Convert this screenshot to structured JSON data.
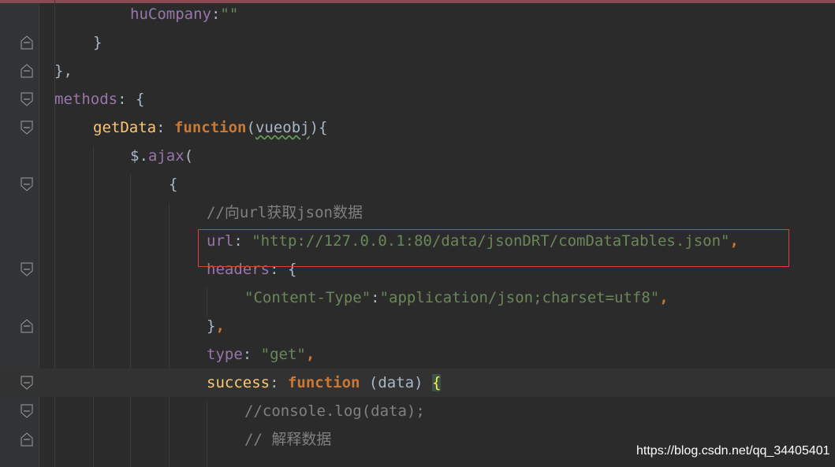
{
  "editor": {
    "lines": [
      {
        "tokens": [
          {
            "t": "huCompany",
            "c": "t-prop"
          },
          {
            "t": ":",
            "c": "t-def"
          },
          {
            "t": "\"\"",
            "c": "t-str"
          }
        ]
      },
      {
        "tokens": [
          {
            "t": "}",
            "c": "t-def"
          }
        ]
      },
      {
        "tokens": [
          {
            "t": "},",
            "c": "t-def"
          }
        ]
      },
      {
        "tokens": [
          {
            "t": "methods",
            "c": "t-prop"
          },
          {
            "t": ": {",
            "c": "t-def"
          }
        ]
      },
      {
        "tokens": [
          {
            "t": "getData",
            "c": "t-fn"
          },
          {
            "t": ": ",
            "c": "t-def"
          },
          {
            "t": "function",
            "c": "t-kw"
          },
          {
            "t": "(",
            "c": "t-def"
          },
          {
            "t": "vueobj",
            "c": "t-def wavy"
          },
          {
            "t": "){",
            "c": "t-def"
          }
        ]
      },
      {
        "tokens": [
          {
            "t": "$",
            "c": "t-def"
          },
          {
            "t": ".",
            "c": "t-def"
          },
          {
            "t": "ajax",
            "c": "t-prop"
          },
          {
            "t": "(",
            "c": "t-def"
          }
        ]
      },
      {
        "tokens": [
          {
            "t": "{",
            "c": "t-def"
          }
        ]
      },
      {
        "tokens": [
          {
            "t": "//向url获取json数据",
            "c": "t-cm"
          }
        ]
      },
      {
        "tokens": [
          {
            "t": "url",
            "c": "t-prop"
          },
          {
            "t": ": ",
            "c": "t-def"
          },
          {
            "t": "\"http://127.0.0.1:80/data/jsonDRT/comDataTables.json\"",
            "c": "t-str"
          },
          {
            "t": ",",
            "c": "t-kw"
          }
        ]
      },
      {
        "tokens": [
          {
            "t": "headers",
            "c": "t-prop"
          },
          {
            "t": ": {",
            "c": "t-def"
          }
        ]
      },
      {
        "tokens": [
          {
            "t": "\"Content-Type\"",
            "c": "t-str"
          },
          {
            "t": ":",
            "c": "t-def"
          },
          {
            "t": "\"application/json;charset=utf8\"",
            "c": "t-str"
          },
          {
            "t": ",",
            "c": "t-kw"
          }
        ]
      },
      {
        "tokens": [
          {
            "t": "}",
            "c": "t-def"
          },
          {
            "t": ",",
            "c": "t-kw"
          }
        ]
      },
      {
        "tokens": [
          {
            "t": "type",
            "c": "t-prop"
          },
          {
            "t": ": ",
            "c": "t-def"
          },
          {
            "t": "\"get\"",
            "c": "t-str"
          },
          {
            "t": ",",
            "c": "t-kw"
          }
        ]
      },
      {
        "tokens": [
          {
            "t": "success",
            "c": "t-fn"
          },
          {
            "t": ": ",
            "c": "t-def"
          },
          {
            "t": "function",
            "c": "t-kw"
          },
          {
            "t": " (data) ",
            "c": "t-def"
          },
          {
            "t": "{",
            "c": "brace-hl"
          }
        ]
      },
      {
        "tokens": [
          {
            "t": "//console.log(data);",
            "c": "t-cm"
          }
        ]
      },
      {
        "tokens": [
          {
            "t": "// 解释数据",
            "c": "t-cm"
          }
        ]
      }
    ]
  },
  "watermark": "https://blog.csdn.net/qq_34405401",
  "colors": {
    "background": "#2b2b2b",
    "gutter": "#313335",
    "property": "#9876aa",
    "string": "#6a8759",
    "keyword": "#cc7832",
    "function": "#ffc66d",
    "comment": "#808080",
    "highlight_box": "#e23c3c"
  }
}
